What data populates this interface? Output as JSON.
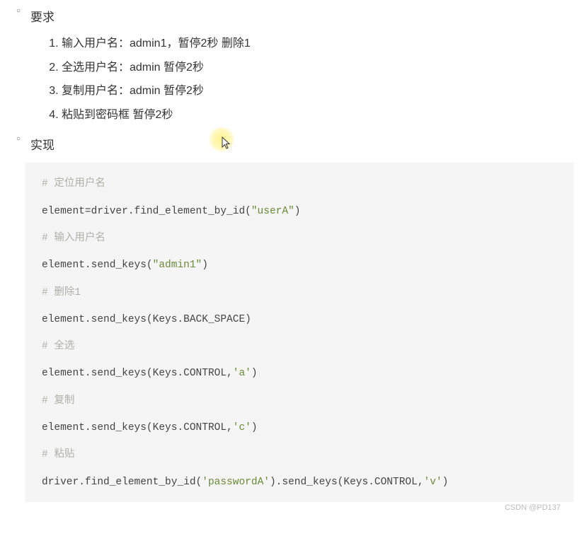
{
  "sections": {
    "requirements_title": "要求",
    "implementation_title": "实现"
  },
  "steps": [
    "输入用户名：admin1，暂停2秒 删除1",
    "全选用户名：admin 暂停2秒",
    "复制用户名：admin 暂停2秒",
    "粘贴到密码框 暂停2秒"
  ],
  "code": {
    "c1": "# 定位用户名",
    "l1a": "element=driver.find_element_by_id(",
    "l1s": "\"userA\"",
    "l1b": ")",
    "c2": "# 输入用户名",
    "l2a": "element.send_keys(",
    "l2s": "\"admin1\"",
    "l2b": ")",
    "c3": "# 删除1",
    "l3": "element.send_keys(Keys.BACK_SPACE)",
    "c4": "# 全选",
    "l4a": "element.send_keys(Keys.CONTROL,",
    "l4s": "'a'",
    "l4b": ")",
    "c5": "# 复制",
    "l5a": "element.send_keys(Keys.CONTROL,",
    "l5s": "'c'",
    "l5b": ")",
    "c6": "# 粘贴",
    "l6a": "driver.find_element_by_id(",
    "l6s1": "'passwordA'",
    "l6b": ").send_keys(Keys.CONTROL,",
    "l6s2": "'v'",
    "l6c": ")"
  },
  "watermark": "CSDN @PD137"
}
